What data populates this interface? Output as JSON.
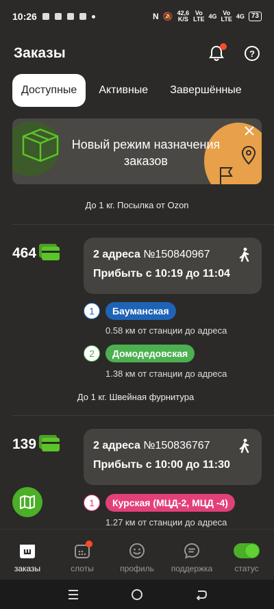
{
  "status_bar": {
    "time": "10:26",
    "net_speed": "42,6\nK/S",
    "sim1": "Vo\nLTE",
    "sim1_sig": "4G",
    "sim2": "Vo\nLTE",
    "sim2_sig": "4G",
    "battery": "73"
  },
  "header": {
    "title": "Заказы"
  },
  "tabs": [
    {
      "label": "Доступные",
      "active": true
    },
    {
      "label": "Активные",
      "active": false
    },
    {
      "label": "Завершённые",
      "active": false
    }
  ],
  "banner": {
    "text": "Новый режим назначения заказов"
  },
  "captions": {
    "first": "До 1 кг. Посылка от Ozon",
    "second": "До 1 кг. Швейная фурнитура"
  },
  "orders": [
    {
      "price": "464",
      "addresses": "2 адреса",
      "number": "№150840967",
      "arrive": "Прибыть с 10:19 до 11:04",
      "stops": [
        {
          "num": "1",
          "station": "Бауманская",
          "color": "#1e63b6",
          "distance": "0.58 км от станции до адреса"
        },
        {
          "num": "2",
          "station": "Домодедовская",
          "color": "#4caf50",
          "distance": "1.38 км от станции до адреса"
        }
      ]
    },
    {
      "price": "139",
      "addresses": "2 адреса",
      "number": "№150836767",
      "arrive": "Прибыть с 10:00 до 11:30",
      "stops": [
        {
          "num": "1",
          "station": "Курская (МЦД-2, МЦД -4)",
          "color": "#e3407a",
          "distance": "1.27 км от станции до адреса"
        }
      ]
    }
  ],
  "bottom_nav": [
    {
      "label": "заказы",
      "icon": "orders-icon",
      "active": true
    },
    {
      "label": "слоты",
      "icon": "calendar-icon",
      "active": false
    },
    {
      "label": "профиль",
      "icon": "smile-icon",
      "active": false
    },
    {
      "label": "поддержка",
      "icon": "chat-icon",
      "active": false
    },
    {
      "label": "статус",
      "icon": "toggle-icon",
      "active": false
    }
  ],
  "colors": {
    "accent_green": "#4caf28",
    "notification": "#ff4a2a",
    "background": "#2b2a28"
  }
}
